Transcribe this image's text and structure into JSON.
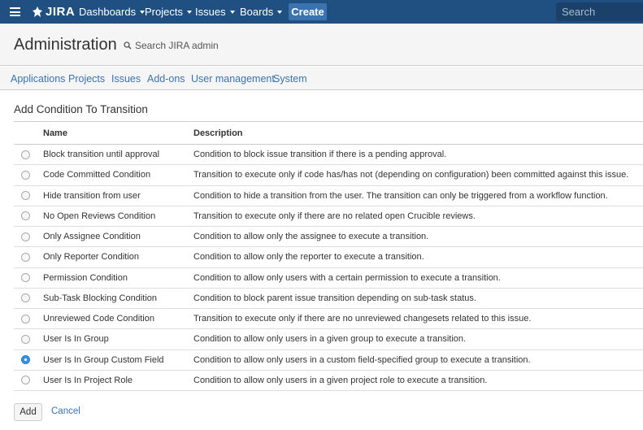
{
  "topnav": {
    "logo": "JIRA",
    "items": [
      {
        "label": "Dashboards",
        "left": 0
      },
      {
        "label": "Projects"
      },
      {
        "label": "Issues"
      },
      {
        "label": "Boards"
      }
    ],
    "create_label": "Create",
    "search_placeholder": "Search"
  },
  "admin": {
    "title": "Administration",
    "search_label": "Search JIRA admin",
    "tabs": [
      "Applications",
      "Projects",
      "Issues",
      "Add-ons",
      "User management",
      "System"
    ]
  },
  "section_title": "Add Condition To Transition",
  "table": {
    "headers": {
      "name": "Name",
      "description": "Description"
    },
    "rows": [
      {
        "name": "Block transition until approval",
        "description": "Condition to block issue transition if there is a pending approval.",
        "selected": false
      },
      {
        "name": "Code Committed Condition",
        "description": "Transition to execute only if code has/has not (depending on configuration) been committed against this issue.",
        "selected": false
      },
      {
        "name": "Hide transition from user",
        "description": "Condition to hide a transition from the user. The transition can only be triggered from a workflow function.",
        "selected": false
      },
      {
        "name": "No Open Reviews Condition",
        "description": "Transition to execute only if there are no related open Crucible reviews.",
        "selected": false
      },
      {
        "name": "Only Assignee Condition",
        "description": "Condition to allow only the assignee to execute a transition.",
        "selected": false
      },
      {
        "name": "Only Reporter Condition",
        "description": "Condition to allow only the reporter to execute a transition.",
        "selected": false
      },
      {
        "name": "Permission Condition",
        "description": "Condition to allow only users with a certain permission to execute a transition.",
        "selected": false
      },
      {
        "name": "Sub-Task Blocking Condition",
        "description": "Condition to block parent issue transition depending on sub-task status.",
        "selected": false
      },
      {
        "name": "Unreviewed Code Condition",
        "description": "Transition to execute only if there are no unreviewed changesets related to this issue.",
        "selected": false
      },
      {
        "name": "User Is In Group",
        "description": "Condition to allow only users in a given group to execute a transition.",
        "selected": false
      },
      {
        "name": "User Is In Group Custom Field",
        "description": "Condition to allow only users in a custom field-specified group to execute a transition.",
        "selected": true
      },
      {
        "name": "User Is In Project Role",
        "description": "Condition to allow only users in a given project role to execute a transition.",
        "selected": false
      }
    ]
  },
  "actions": {
    "add_label": "Add",
    "cancel_label": "Cancel"
  }
}
